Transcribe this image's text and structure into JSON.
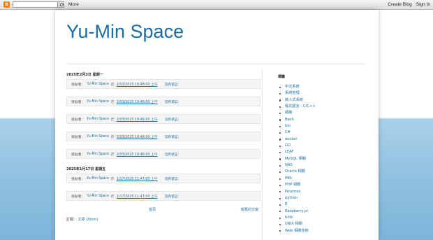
{
  "navbar": {
    "logo_letter": "B",
    "more_label": "More",
    "create_blog_label": "Create Blog",
    "sign_in_label": "Sign In"
  },
  "blog": {
    "title": "Yu-Min Space"
  },
  "date_groups": [
    {
      "date": "2025年2月3日 星期一",
      "posts": [
        {
          "posted_by": "張貼者：",
          "author": "Yu-Min Space",
          "at": "於",
          "time": "2/03/2025 10:48:00 上午",
          "comments": "沒有留言:"
        },
        {
          "posted_by": "張貼者：",
          "author": "Yu-Min Space",
          "at": "於",
          "time": "2/03/2025 10:48:00 上午",
          "comments": "沒有留言:"
        },
        {
          "posted_by": "張貼者：",
          "author": "Yu-Min Space",
          "at": "於",
          "time": "2/03/2025 10:48:00 上午",
          "comments": "沒有留言:"
        },
        {
          "posted_by": "張貼者：",
          "author": "Yu-Min Space",
          "at": "於",
          "time": "2/03/2025 10:48:00 上午",
          "comments": "沒有留言:"
        },
        {
          "posted_by": "張貼者：",
          "author": "Yu-Min Space",
          "at": "於",
          "time": "2/03/2025 10:48:00 上午",
          "comments": "沒有留言:"
        }
      ]
    },
    {
      "date": "2025年1月17日 星期五",
      "posts": [
        {
          "posted_by": "張貼者：",
          "author": "Yu-Min Space",
          "at": "於",
          "time": "1/17/2025 11:47:00 上午",
          "comments": "沒有留言:"
        },
        {
          "posted_by": "張貼者：",
          "author": "Yu-Min Space",
          "at": "於",
          "time": "1/17/2025 11:47:00 上午",
          "comments": "沒有留言:"
        }
      ]
    }
  ],
  "pager": {
    "home_label": "首頁",
    "older_label": "較舊的文章"
  },
  "subscribe": {
    "label": "訂閱：",
    "link": "文章 (Atom)"
  },
  "sidebar": {
    "title": "標籤",
    "labels": [
      "中文系統",
      "系統管理",
      "嵌入式系統",
      "程式語言 - C/C++",
      "網路",
      "Bash",
      "bio",
      "C#",
      "docker",
      "GO",
      "LEAF",
      "MySQL 相關",
      "NAS",
      "Oracle 相關",
      "PBS",
      "PHP 相關",
      "Proxmox",
      "python",
      "R",
      "Raspberry pi",
      "tcltk",
      "UNIX 相關",
      "Web 相關技術"
    ]
  }
}
